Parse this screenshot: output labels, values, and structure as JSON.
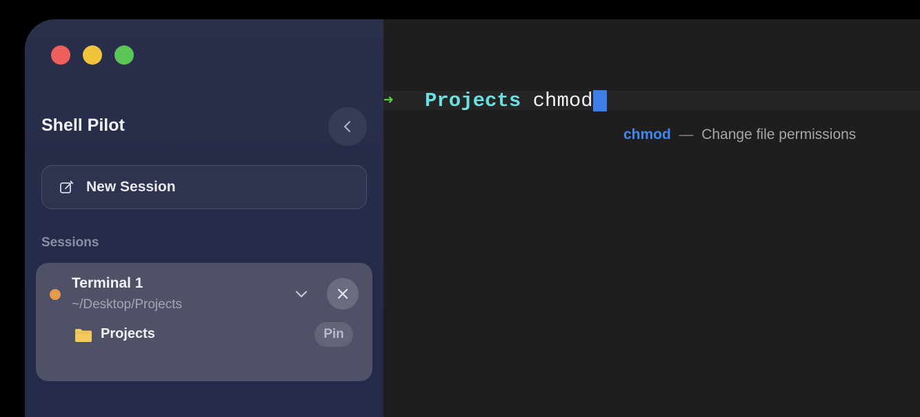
{
  "window": {
    "traffic_lights": [
      "close",
      "minimize",
      "zoom"
    ]
  },
  "sidebar": {
    "app_title": "Shell Pilot",
    "collapse_icon": "chevron-left-icon",
    "new_session": {
      "label": "New Session",
      "icon": "compose-icon"
    },
    "sessions_heading": "Sessions",
    "sessions": [
      {
        "name": "Terminal 1",
        "path": "~/Desktop/Projects",
        "status_color": "#e59a4c",
        "folder": {
          "name": "Projects",
          "icon": "folder-icon",
          "pin_label": "Pin"
        }
      }
    ]
  },
  "terminal": {
    "prompt_arrow": "➜",
    "current_dir": "Projects",
    "input": "chmod",
    "suggestion": {
      "command": "chmod",
      "separator": "—",
      "description": "Change file permissions"
    }
  },
  "colors": {
    "accent": "#3d7ee8",
    "prompt_arrow": "#5fcf4a",
    "directory": "#6ce0e0"
  }
}
